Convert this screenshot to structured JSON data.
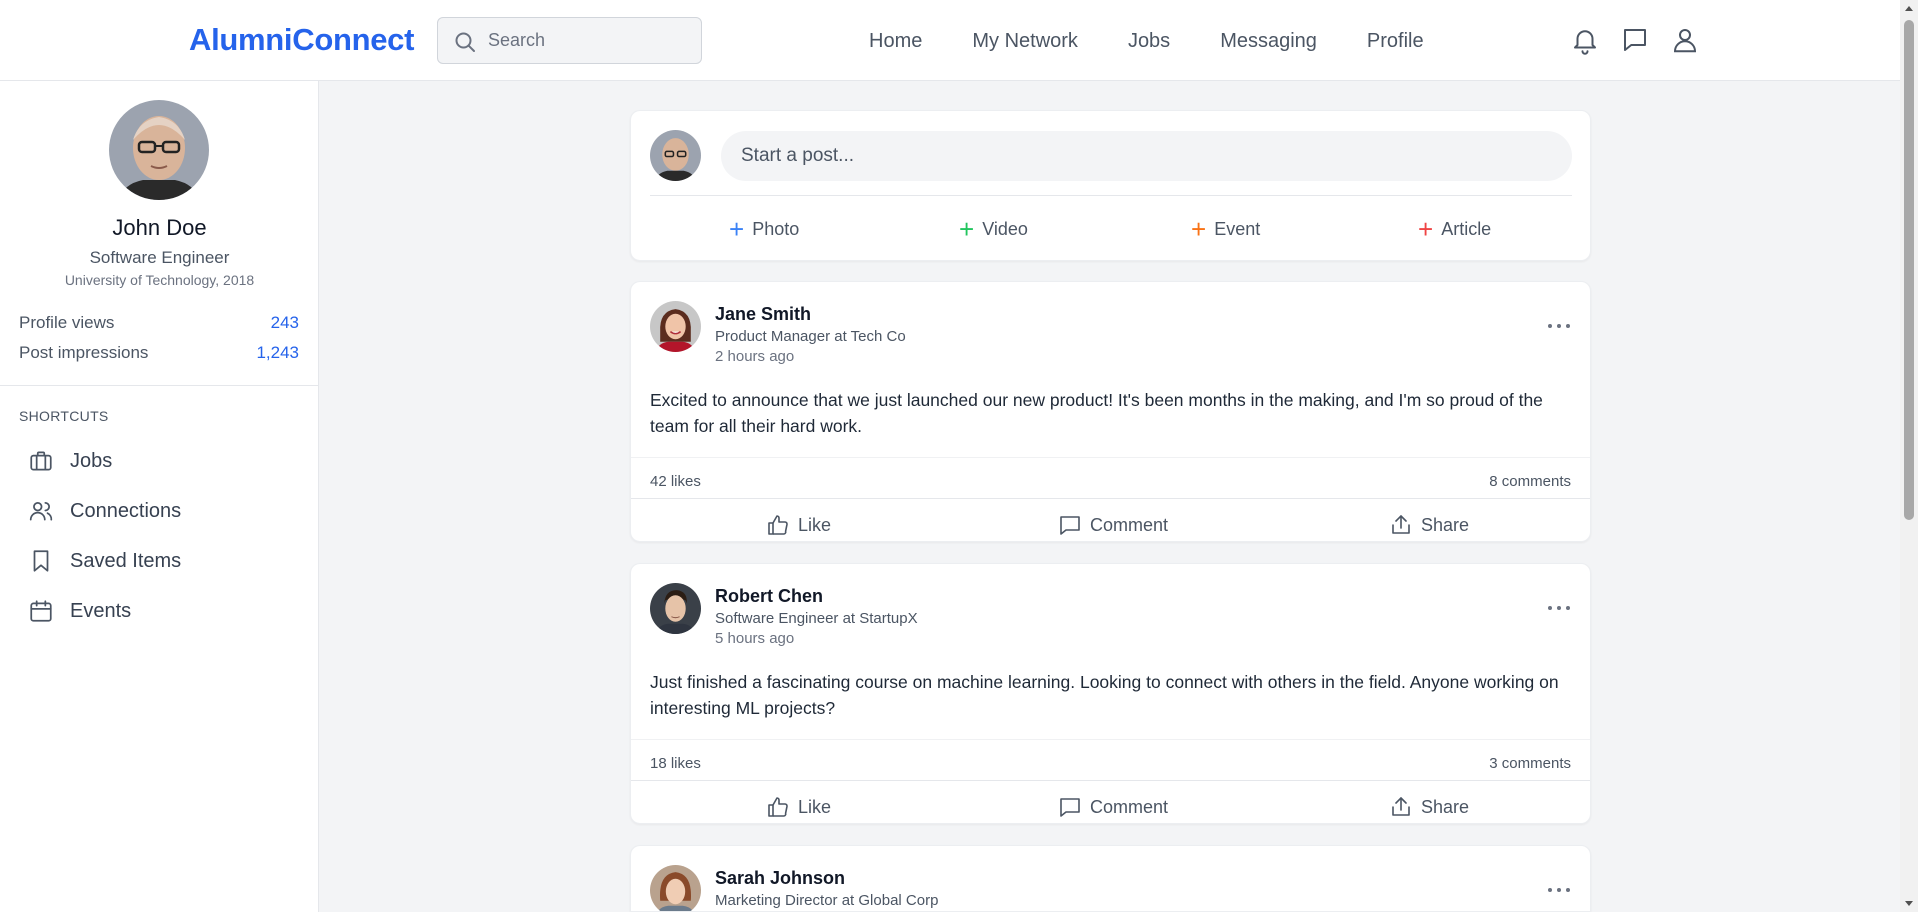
{
  "app": {
    "logo": "AlumniConnect"
  },
  "search": {
    "placeholder": "Search"
  },
  "nav": {
    "items": [
      "Home",
      "My Network",
      "Jobs",
      "Messaging",
      "Profile"
    ]
  },
  "header_icons": [
    "bell-icon",
    "chat-icon",
    "user-icon"
  ],
  "profile": {
    "name": "John Doe",
    "title": "Software Engineer",
    "education": "University of Technology, 2018",
    "stats": [
      {
        "label": "Profile views",
        "value": "243"
      },
      {
        "label": "Post impressions",
        "value": "1,243"
      }
    ]
  },
  "shortcuts": {
    "heading": "SHORTCUTS",
    "items": [
      {
        "label": "Jobs",
        "icon": "briefcase-icon"
      },
      {
        "label": "Connections",
        "icon": "users-icon"
      },
      {
        "label": "Saved Items",
        "icon": "bookmark-icon"
      },
      {
        "label": "Events",
        "icon": "calendar-icon"
      }
    ]
  },
  "composer": {
    "placeholder": "Start a post...",
    "actions": [
      {
        "label": "Photo",
        "color": "#3b82f6"
      },
      {
        "label": "Video",
        "color": "#22c55e"
      },
      {
        "label": "Event",
        "color": "#f97316"
      },
      {
        "label": "Article",
        "color": "#ef4444"
      }
    ]
  },
  "posts": [
    {
      "author": "Jane Smith",
      "role": "Product Manager at Tech Co",
      "time": "2 hours ago",
      "body": "Excited to announce that we just launched our new product! It's been months in the making, and I'm so proud of the team for all their hard work.",
      "likes": "42 likes",
      "comments": "8 comments"
    },
    {
      "author": "Robert Chen",
      "role": "Software Engineer at StartupX",
      "time": "5 hours ago",
      "body": "Just finished a fascinating course on machine learning. Looking to connect with others in the field. Anyone working on interesting ML projects?",
      "likes": "18 likes",
      "comments": "3 comments"
    },
    {
      "author": "Sarah Johnson",
      "role": "Marketing Director at Global Corp"
    }
  ],
  "post_actions": {
    "like": "Like",
    "comment": "Comment",
    "share": "Share"
  },
  "colors": {
    "brand": "#2563eb",
    "background": "#f3f4f6"
  }
}
